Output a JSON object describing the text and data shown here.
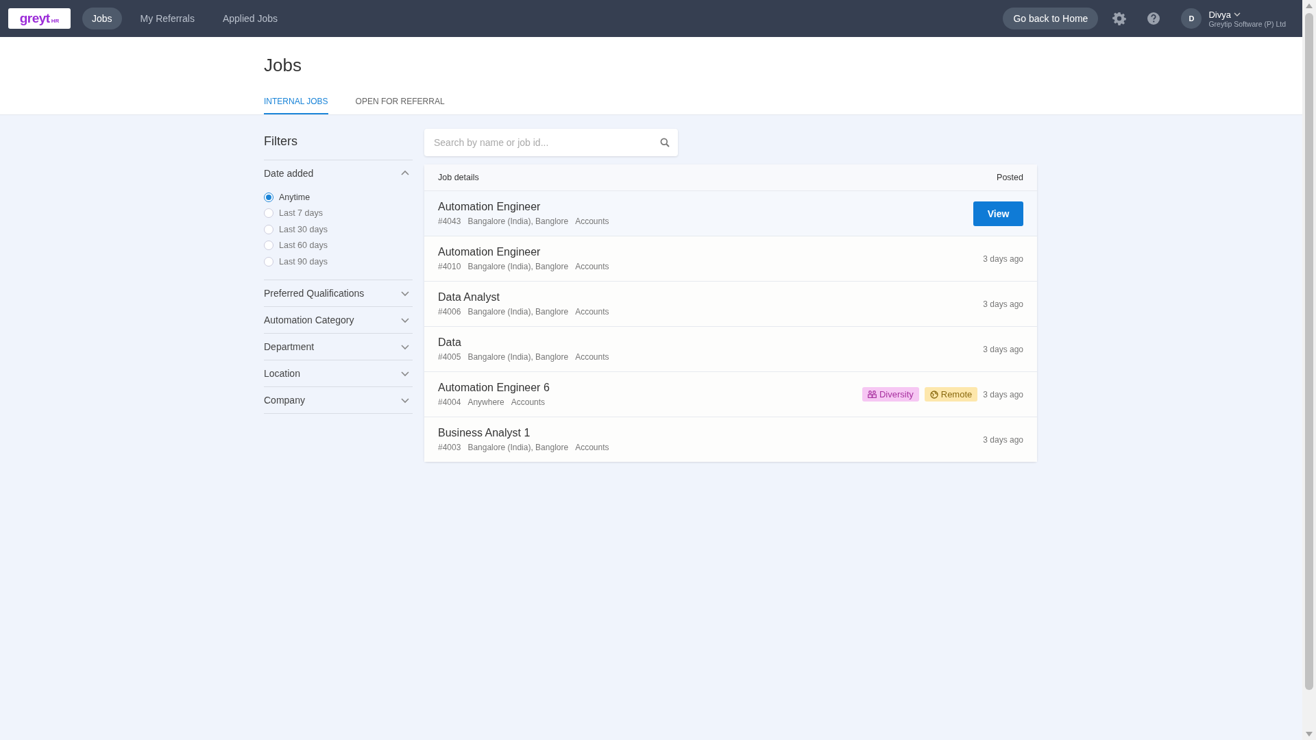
{
  "topbar": {
    "logo": {
      "text": "greyt",
      "sub": "HR"
    },
    "nav": [
      {
        "label": "Jobs",
        "selected": true
      },
      {
        "label": "My Referrals",
        "selected": false
      },
      {
        "label": "Applied Jobs",
        "selected": false
      }
    ],
    "home_button": "Go back to Home",
    "user": {
      "initial": "D",
      "name": "Divya",
      "company": "Greytip Software (P) Ltd"
    }
  },
  "page": {
    "title": "Jobs",
    "tabs": [
      {
        "label": "INTERNAL JOBS",
        "selected": true
      },
      {
        "label": "OPEN FOR REFERRAL",
        "selected": false
      }
    ]
  },
  "filters": {
    "title": "Filters",
    "sections": [
      {
        "label": "Date added",
        "expanded": true,
        "options": [
          {
            "label": "Anytime",
            "selected": true
          },
          {
            "label": "Last 7 days",
            "selected": false
          },
          {
            "label": "Last 30 days",
            "selected": false
          },
          {
            "label": "Last 60 days",
            "selected": false
          },
          {
            "label": "Last 90 days",
            "selected": false
          }
        ]
      },
      {
        "label": "Preferred Qualifications",
        "expanded": false
      },
      {
        "label": "Automation Category",
        "expanded": false
      },
      {
        "label": "Department",
        "expanded": false
      },
      {
        "label": "Location",
        "expanded": false
      },
      {
        "label": "Company",
        "expanded": false
      }
    ]
  },
  "search": {
    "placeholder": "Search by name or job id..."
  },
  "jobs": {
    "columns": [
      "Job details",
      "Posted"
    ],
    "rows": [
      {
        "title": "Automation Engineer",
        "meta": [
          "#4043",
          "Bangalore (India), Banglore",
          "Accounts"
        ],
        "action": "View"
      },
      {
        "title": "Automation Engineer",
        "meta": [
          "#4010",
          "Bangalore (India), Banglore",
          "Accounts"
        ],
        "posted": "3 days ago"
      },
      {
        "title": "Data Analyst",
        "meta": [
          "#4006",
          "Bangalore (India), Banglore",
          "Accounts"
        ],
        "posted": "3 days ago"
      },
      {
        "title": "Data",
        "meta": [
          "#4005",
          "Bangalore (India), Banglore",
          "Accounts"
        ],
        "posted": "3 days ago"
      },
      {
        "title": "Automation Engineer 6",
        "meta": [
          "#4004",
          "Anywhere",
          "Accounts"
        ],
        "posted": "3 days ago",
        "tags": [
          {
            "kind": "diversity",
            "label": "Diversity"
          },
          {
            "kind": "remote",
            "label": "Remote"
          }
        ]
      },
      {
        "title": "Business Analyst 1",
        "meta": [
          "#4003",
          "Bangalore (India), Banglore",
          "Accounts"
        ],
        "posted": "3 days ago"
      }
    ]
  }
}
